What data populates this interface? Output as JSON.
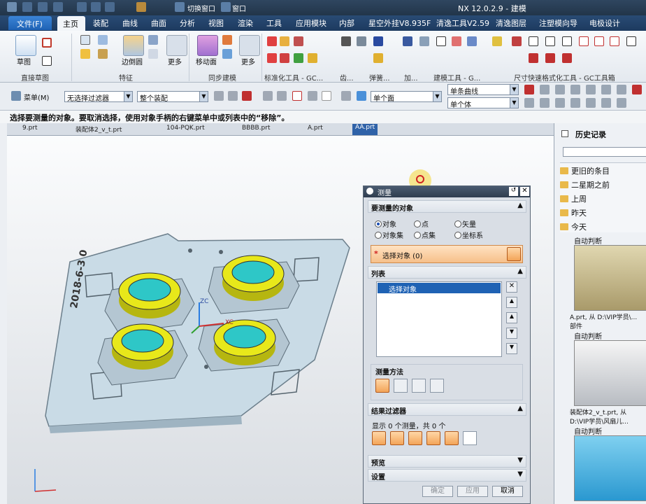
{
  "titlebar": {
    "title": "NX 12.0.2.9 - 建模",
    "switch_window": "切换窗口",
    "window_menu": "窗口"
  },
  "ribbon_tabs": [
    "文件(F)",
    "主页",
    "装配",
    "曲线",
    "曲面",
    "分析",
    "视图",
    "渲染",
    "工具",
    "应用模块",
    "内部",
    "星空外挂V8.935F",
    "清逸工具V2.59",
    "清逸图层",
    "注塑模向导",
    "电极设计"
  ],
  "ribbon_groups": [
    "直接草图",
    "特征",
    "同步建模",
    "标准化工具 - GC...",
    "齿...",
    "弹簧...",
    "加...",
    "建模工具 - G...",
    "尺寸快速格式化工具 - GC工具箱"
  ],
  "ribbon_buttons": {
    "sketch": "草图",
    "edge_blend": "边倒圆",
    "more": "更多",
    "move_face": "移动面",
    "more2": "更多"
  },
  "toolbar2": {
    "menu": "菜单(M)",
    "filter": "无选择过滤器",
    "assembly": "整个装配",
    "face": "单个面",
    "curve": "单条曲线",
    "body": "单个体"
  },
  "cue_line": "选择要测量的对象。要取消选择，使用对象手柄的右键菜单中或列表中的“移除”。",
  "file_tabs": [
    "9.prt",
    "装配体2_v_t.prt",
    "104-PQK.prt",
    "BBBB.prt",
    "A.prt",
    "AA.prt"
  ],
  "history": {
    "title": "历史记录",
    "groups": [
      "更旧的条目",
      "二星期之前",
      "上周",
      "昨天",
      "今天"
    ],
    "items": [
      {
        "kind": "自动判断",
        "caption": "A.prt, 从 D:\\VIP学员\\... 部件"
      },
      {
        "kind": "自动判断",
        "caption": "装配体2_v_t.prt, 从 D:\\VIP学员\\风扇儿..."
      },
      {
        "kind": "自动判断",
        "caption": ""
      }
    ]
  },
  "dialog": {
    "title": "测量",
    "section_objects": "要测量的对象",
    "radios": [
      {
        "label": "对象",
        "on": true
      },
      {
        "label": "点",
        "on": false
      },
      {
        "label": "矢量",
        "on": false
      },
      {
        "label": "对象集",
        "on": false
      },
      {
        "label": "点集",
        "on": false
      },
      {
        "label": "坐标系",
        "on": false
      }
    ],
    "select_object": "选择对象 (0)",
    "section_list": "列表",
    "list_item": "选择对象",
    "section_method": "测量方法",
    "section_filter": "结果过滤器",
    "filter_text": "显示 0 个测量，共 0 个",
    "section_preview": "预览",
    "section_settings": "设置",
    "ok": "确定",
    "apply": "应用",
    "cancel": "取消"
  },
  "model": {
    "engraving": "2018-6-3 0",
    "axis_zc": "ZC",
    "axis_xc": "XC"
  },
  "colors": {
    "accent_blue": "#1f62b4",
    "highlight_orange": "#f3a458",
    "model_plate": "#c9dbe6",
    "ring_yellow": "#e8e81a",
    "ring_cyan": "#2ec7c7"
  }
}
